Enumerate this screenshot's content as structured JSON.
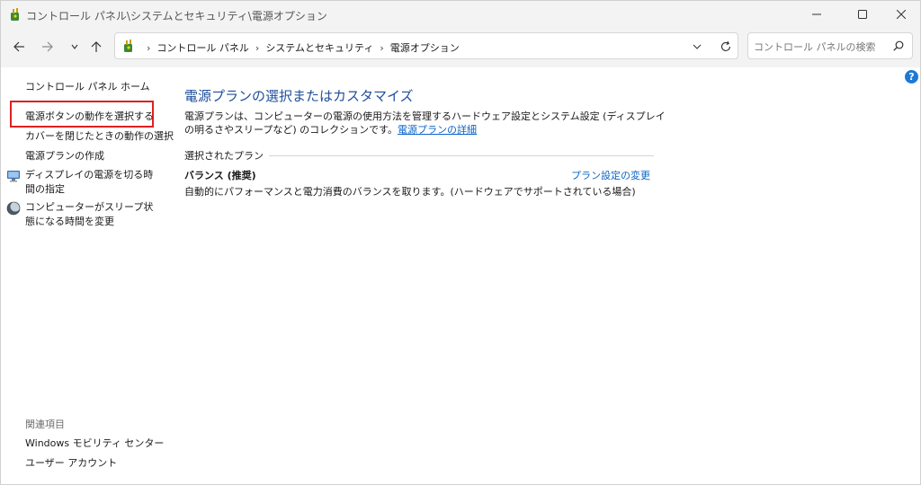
{
  "window": {
    "title": "コントロール パネル\\システムとセキュリティ\\電源オプション"
  },
  "address": {
    "crumbs": [
      "コントロール パネル",
      "システムとセキュリティ",
      "電源オプション"
    ]
  },
  "search": {
    "placeholder": "コントロール パネルの検索"
  },
  "sidebar": {
    "home": "コントロール パネル ホーム",
    "items": [
      "電源ボタンの動作を選択する",
      "カバーを閉じたときの動作の選択",
      "電源プランの作成",
      "ディスプレイの電源を切る時間の指定",
      "コンピューターがスリープ状態になる時間を変更"
    ],
    "related_heading": "関連項目",
    "related": [
      "Windows モビリティ センター",
      "ユーザー アカウント"
    ]
  },
  "main": {
    "heading": "電源プランの選択またはカスタマイズ",
    "description": "電源プランは、コンピューターの電源の使用方法を管理するハードウェア設定とシステム設定 (ディスプレイの明るさやスリープなど) のコレクションです。",
    "details_link": "電源プランの詳細",
    "section_label": "選択されたプラン",
    "plan": {
      "name": "バランス (推奨)",
      "change_link": "プラン設定の変更",
      "description": "自動的にパフォーマンスと電力消費のバランスを取ります。(ハードウェアでサポートされている場合)"
    }
  },
  "icons": {
    "app": "power-options-icon",
    "help": "help-icon"
  },
  "colors": {
    "highlight": "#e02020",
    "link": "#0a64c8",
    "heading": "#1e4e9c"
  }
}
